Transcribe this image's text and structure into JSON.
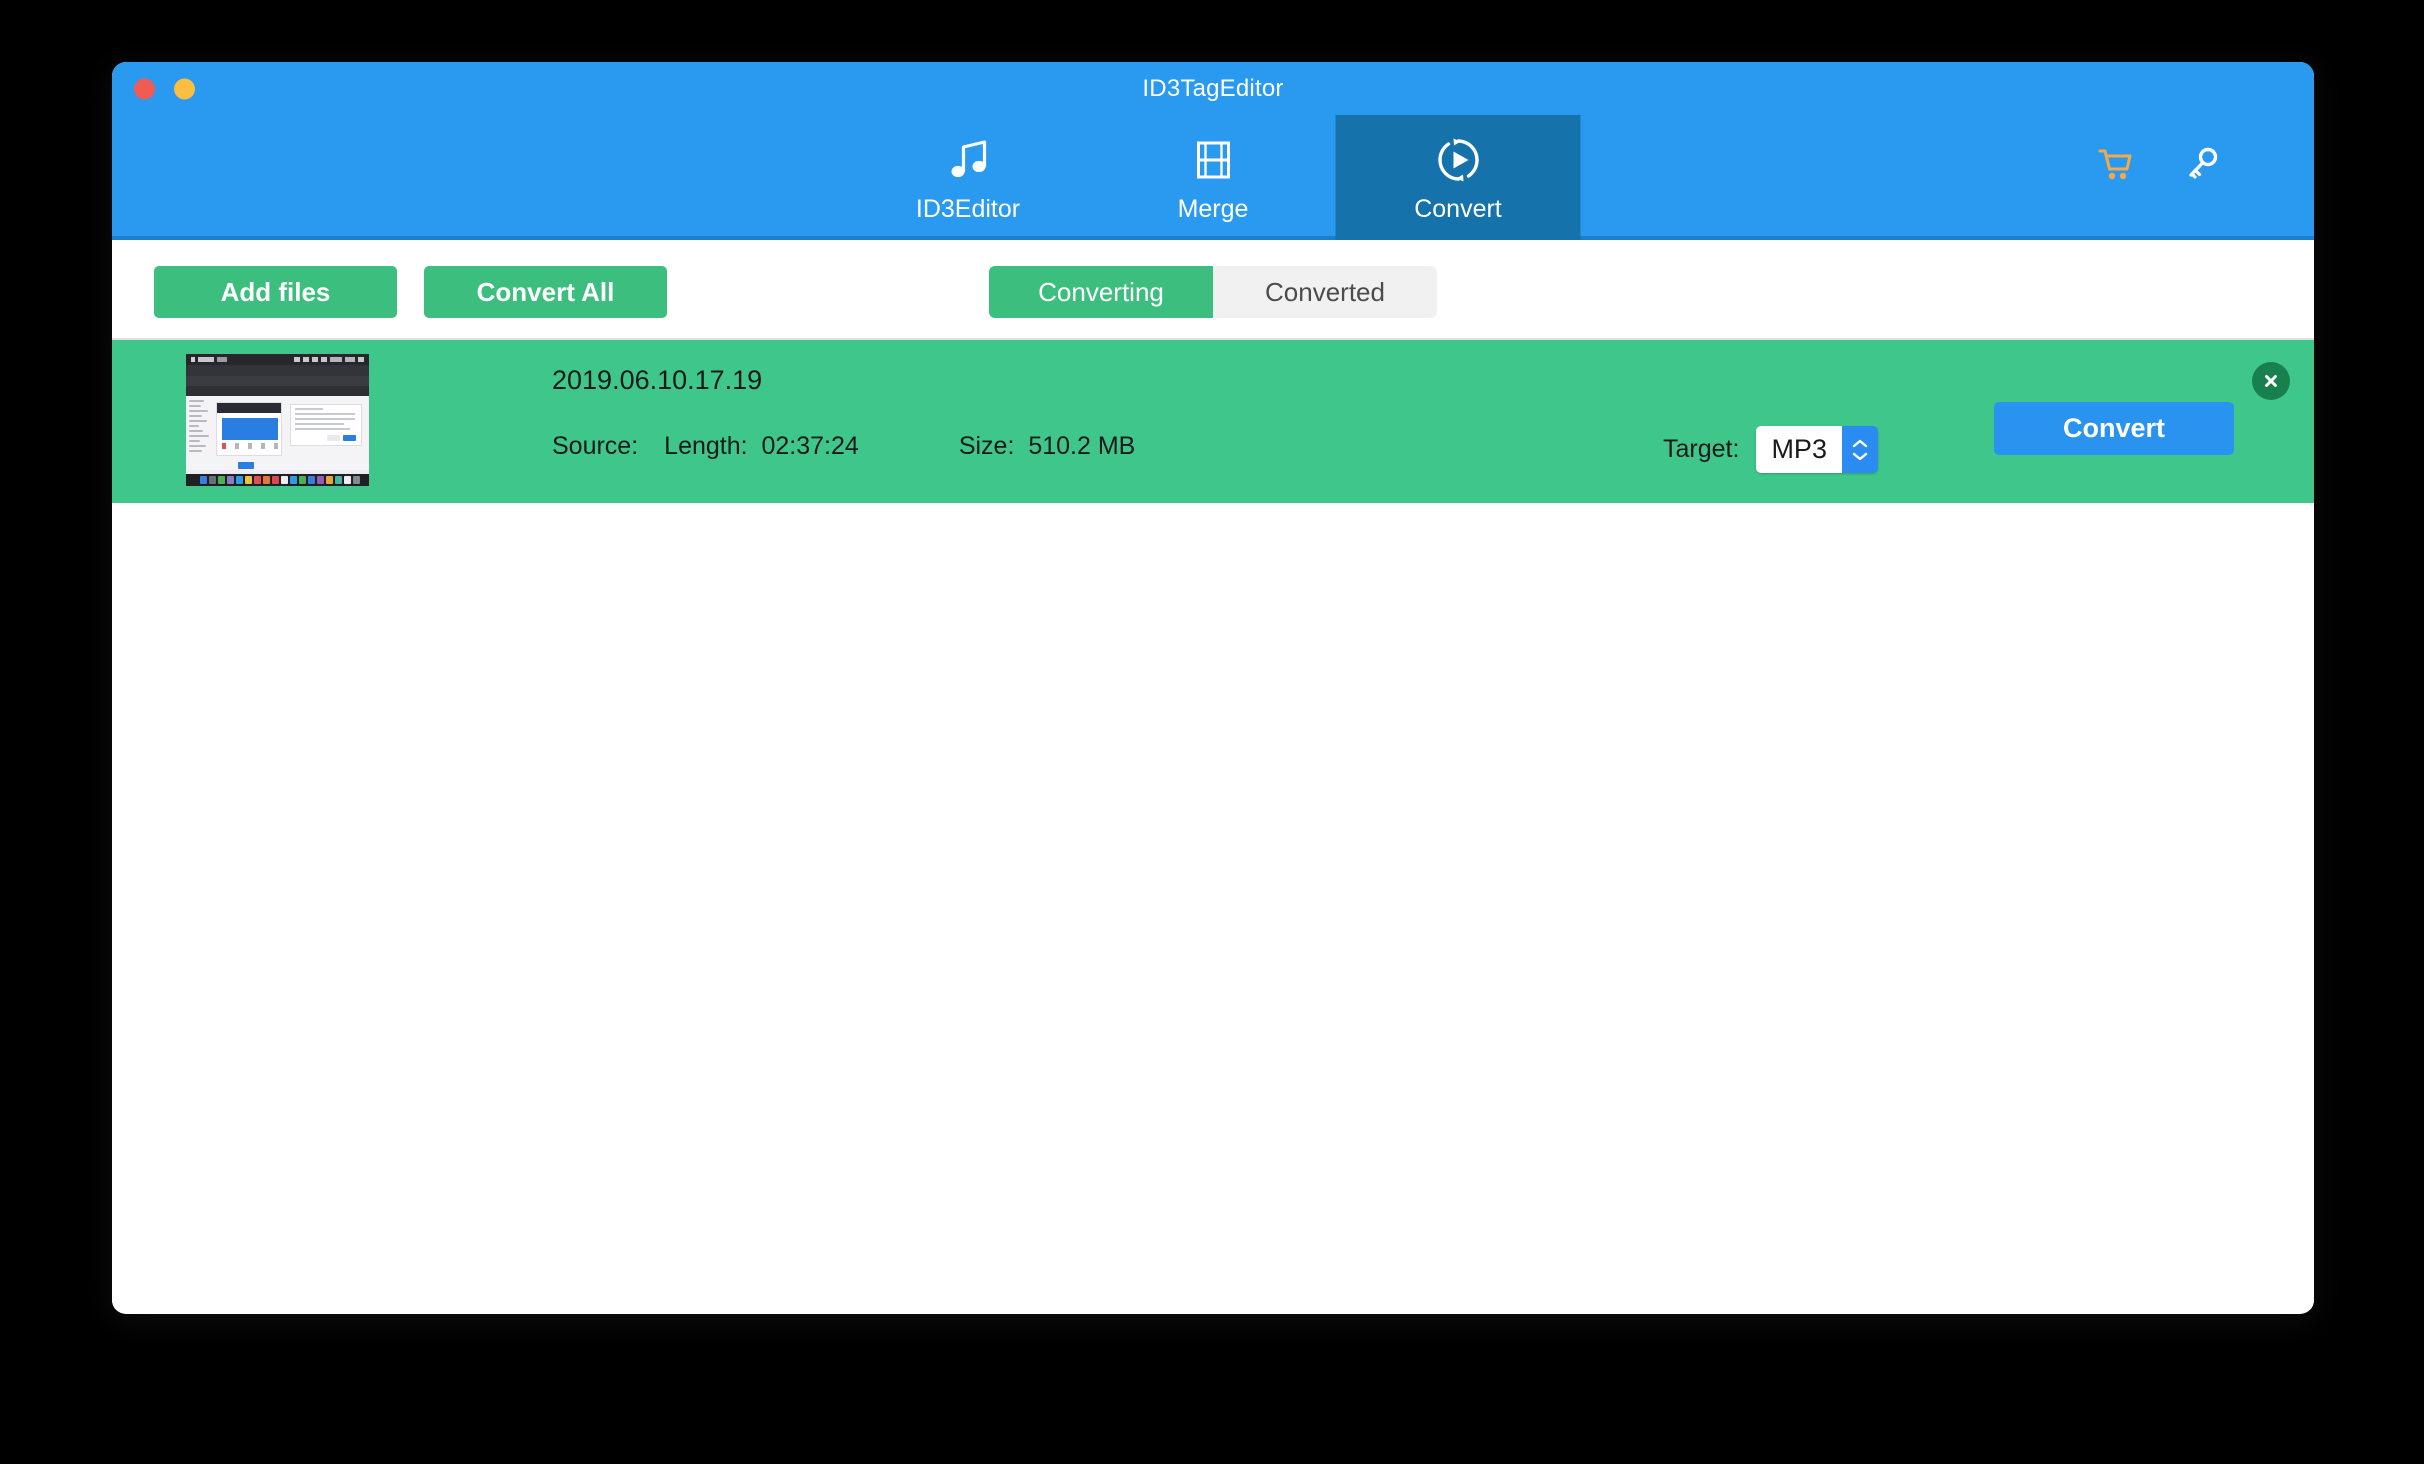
{
  "window": {
    "title": "ID3TagEditor",
    "traffic_lights": [
      "close",
      "minimize"
    ]
  },
  "toolbar": {
    "tabs": [
      {
        "label": "ID3Editor",
        "icon": "music-note-icon",
        "active": false
      },
      {
        "label": "Merge",
        "icon": "film-strip-icon",
        "active": false
      },
      {
        "label": "Convert",
        "icon": "convert-play-icon",
        "active": true
      }
    ],
    "header_actions": [
      {
        "icon": "shopping-cart-icon",
        "name": "cart"
      },
      {
        "icon": "key-icon",
        "name": "license-key"
      }
    ]
  },
  "action_bar": {
    "add_files_label": "Add files",
    "convert_all_label": "Convert All",
    "segments": [
      {
        "label": "Converting",
        "active": true
      },
      {
        "label": "Converted",
        "active": false
      }
    ]
  },
  "file_list": {
    "rows": [
      {
        "name": "2019.06.10.17.19",
        "source_label": "Source:",
        "length_label": "Length:",
        "length_value": "02:37:24",
        "size_label": "Size:",
        "size_value": "510.2 MB",
        "target_label": "Target:",
        "target_value": "MP3",
        "convert_label": "Convert",
        "close_icon": "close-icon"
      }
    ]
  },
  "colors": {
    "header_blue": "#2a99f0",
    "active_tab_blue": "#1672ab",
    "toolbar_divider": "#1c7fcc",
    "row_green": "#3fc68a",
    "button_green": "#3cbf7e",
    "convert_blue": "#2a93f0",
    "close_dark_green": "#18804f",
    "traffic_red": "#f05b54",
    "traffic_yellow": "#fcbe40",
    "cart_orange": "#f5a84a",
    "window_bg": "#ffffff",
    "desktop_bg": "#000000"
  }
}
